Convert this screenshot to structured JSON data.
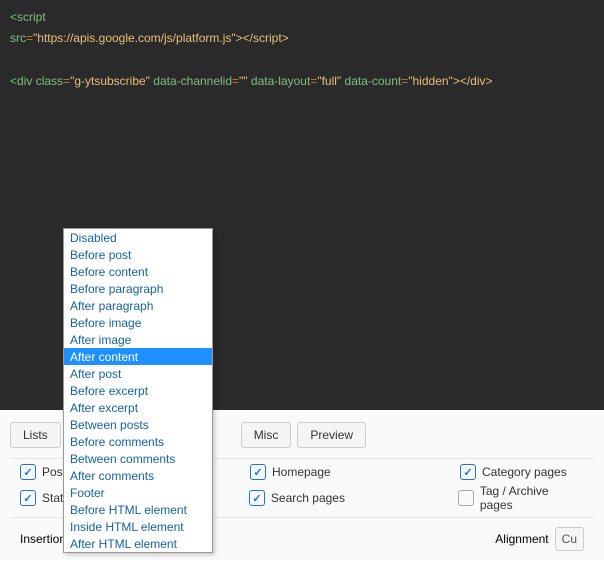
{
  "code": {
    "line1_open": "<script",
    "line2_attr": "src",
    "line2_val": "\"https://apis.google.com/js/platform.js\"",
    "line2_close": "></",
    "line2_closename": "script",
    "line2_end": ">",
    "line4_open": "<div",
    "line4_cls_n": "class",
    "line4_cls_v": "\"g-ytsubscribe\"",
    "line4_a1_n": "data-channelid",
    "line4_a1_v": "\"\"",
    "line4_a2_n": "data-layout",
    "line4_a2_v": "\"full\"",
    "line4_a3_n": "data-count",
    "line4_a3_v": "\"hidden\"",
    "line4_close": "></",
    "line4_closename": "div",
    "line4_end": ">"
  },
  "tabs": {
    "lists": "Lists",
    "misc": "Misc",
    "preview": "Preview"
  },
  "checks": {
    "posts_label": "Posts",
    "static_label": "Static",
    "homepage": "Homepage",
    "search": "Search pages",
    "category": "Category pages",
    "tag": "Tag / Archive pages",
    "posts_checked": true,
    "static_checked": true,
    "homepage_checked": true,
    "search_checked": true,
    "category_checked": true,
    "tag_checked": false
  },
  "insertion": {
    "label": "Insertion",
    "value": "After content",
    "chevron": "⌄"
  },
  "alignment": {
    "label": "Alignment",
    "value": "Cu"
  },
  "dropdown": {
    "items": [
      "Disabled",
      "Before post",
      "Before content",
      "Before paragraph",
      "After paragraph",
      "Before image",
      "After image",
      "After content",
      "After post",
      "Before excerpt",
      "After excerpt",
      "Between posts",
      "Before comments",
      "Between comments",
      "After comments",
      "Footer",
      "Before HTML element",
      "Inside HTML element",
      "After HTML element"
    ],
    "selected_index": 7
  },
  "chk_glyph": "✓"
}
